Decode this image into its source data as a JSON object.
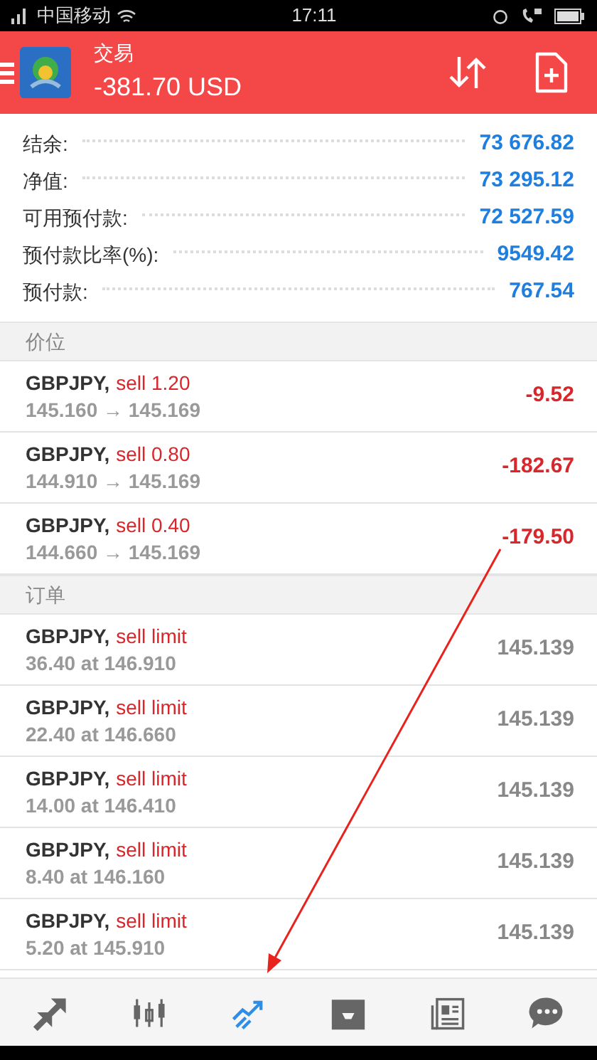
{
  "status_bar": {
    "carrier": "中国移动",
    "time": "17:11"
  },
  "header": {
    "title": "交易",
    "balance": "-381.70 USD"
  },
  "summary": [
    {
      "label": "结余:",
      "value": "73 676.82"
    },
    {
      "label": "净值:",
      "value": "73 295.12"
    },
    {
      "label": "可用预付款:",
      "value": "72 527.59"
    },
    {
      "label": "预付款比率(%):",
      "value": "9549.42"
    },
    {
      "label": "预付款:",
      "value": "767.54"
    }
  ],
  "positions": {
    "title": "价位",
    "rows": [
      {
        "symbol": "GBPJPY,",
        "action": "sell 1.20",
        "prices": "145.160 → 145.169",
        "profit": "-9.52"
      },
      {
        "symbol": "GBPJPY,",
        "action": "sell 0.80",
        "prices": "144.910 → 145.169",
        "profit": "-182.67"
      },
      {
        "symbol": "GBPJPY,",
        "action": "sell 0.40",
        "prices": "144.660 → 145.169",
        "profit": "-179.50"
      }
    ]
  },
  "orders": {
    "title": "订单",
    "rows": [
      {
        "symbol": "GBPJPY,",
        "action": "sell limit",
        "detail": "36.40 at 146.910",
        "price": "145.139"
      },
      {
        "symbol": "GBPJPY,",
        "action": "sell limit",
        "detail": "22.40 at 146.660",
        "price": "145.139"
      },
      {
        "symbol": "GBPJPY,",
        "action": "sell limit",
        "detail": "14.00 at 146.410",
        "price": "145.139"
      },
      {
        "symbol": "GBPJPY,",
        "action": "sell limit",
        "detail": "8.40 at 146.160",
        "price": "145.139"
      },
      {
        "symbol": "GBPJPY,",
        "action": "sell limit",
        "detail": "5.20 at 145.910",
        "price": "145.139"
      }
    ]
  },
  "bottom_nav": [
    {
      "kind": "quotes",
      "selected": false
    },
    {
      "kind": "chart",
      "selected": false
    },
    {
      "kind": "trade",
      "selected": true
    },
    {
      "kind": "history",
      "selected": false
    },
    {
      "kind": "news",
      "selected": false
    },
    {
      "kind": "chat",
      "selected": false
    }
  ]
}
